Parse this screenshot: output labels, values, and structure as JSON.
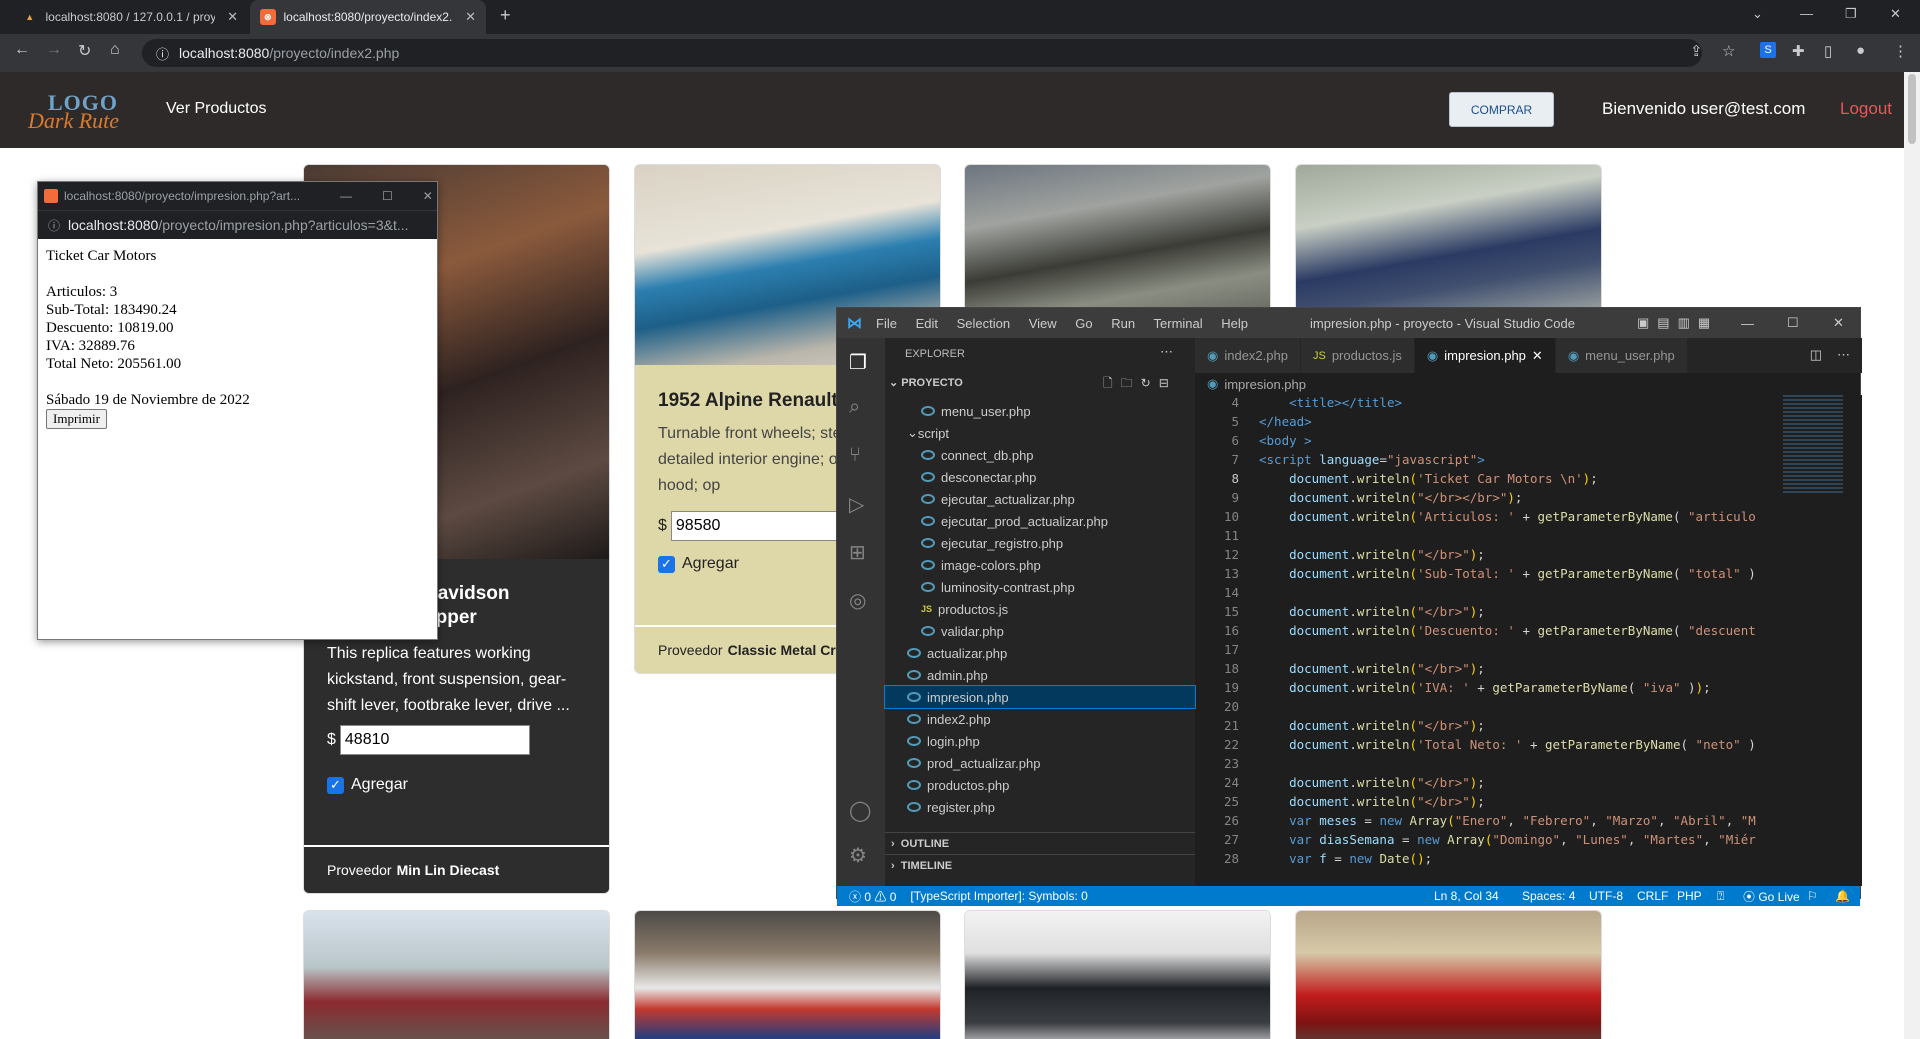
{
  "browser": {
    "tabs": [
      {
        "label": "localhost:8080 / 127.0.0.1 / proye"
      },
      {
        "label": "localhost:8080/proyecto/index2.p"
      }
    ],
    "url_host": "localhost:8080",
    "url_path": "/proyecto/index2.php"
  },
  "site": {
    "logo_top": "LOGO",
    "logo_bottom": "Dark Rute",
    "nav_link": "Ver Productos",
    "buy_button": "COMPRAR",
    "welcome": "Bienvenido user@test.com",
    "logout": "Logout"
  },
  "products": [
    {
      "title_line1": "Davidson",
      "title_line2": "opper",
      "description": "This replica features working kickstand, front suspension, gear-shift lever, footbrake lever, drive ...",
      "price": "48810",
      "checkbox_label": "Agregar",
      "provider_prefix": "Proveedor",
      "provider": "Min Lin Diecast"
    },
    {
      "title": "1952 Alpine Renault",
      "description": "Turnable front wheels; ste function; detailed interior engine; opening hood; op",
      "price": "98580",
      "checkbox_label": "Agregar",
      "provider_prefix": "Proveedor",
      "provider": "Classic Metal Cre"
    }
  ],
  "popup": {
    "title": "localhost:8080/proyecto/impresion.php?art...",
    "url_host": "localhost:8080",
    "url_path": "/proyecto/impresion.php?articulos=3&t...",
    "heading": "Ticket Car Motors",
    "lines": [
      "Articulos: 3",
      "Sub-Total: 183490.24",
      "Descuento: 10819.00",
      "IVA: 32889.76",
      "Total Neto: 205561.00"
    ],
    "date": "Sábado 19 de Noviembre de 2022",
    "print_button": "Imprimir"
  },
  "vscode": {
    "menu": [
      "File",
      "Edit",
      "Selection",
      "View",
      "Go",
      "Run",
      "Terminal",
      "Help"
    ],
    "window_title": "impresion.php - proyecto - Visual Studio Code",
    "explorer_title": "EXPLORER",
    "project": "PROYECTO",
    "tree": [
      {
        "name": "menu_user.php",
        "indent": 2,
        "kind": "php"
      },
      {
        "name": "script",
        "indent": 1,
        "kind": "folder"
      },
      {
        "name": "connect_db.php",
        "indent": 2,
        "kind": "php"
      },
      {
        "name": "desconectar.php",
        "indent": 2,
        "kind": "php"
      },
      {
        "name": "ejecutar_actualizar.php",
        "indent": 2,
        "kind": "php"
      },
      {
        "name": "ejecutar_prod_actualizar.php",
        "indent": 2,
        "kind": "php"
      },
      {
        "name": "ejecutar_registro.php",
        "indent": 2,
        "kind": "php"
      },
      {
        "name": "image-colors.php",
        "indent": 2,
        "kind": "php"
      },
      {
        "name": "luminosity-contrast.php",
        "indent": 2,
        "kind": "php"
      },
      {
        "name": "productos.js",
        "indent": 2,
        "kind": "js"
      },
      {
        "name": "validar.php",
        "indent": 2,
        "kind": "php"
      },
      {
        "name": "actualizar.php",
        "indent": 1,
        "kind": "php"
      },
      {
        "name": "admin.php",
        "indent": 1,
        "kind": "php"
      },
      {
        "name": "impresion.php",
        "indent": 1,
        "kind": "php",
        "selected": true
      },
      {
        "name": "index2.php",
        "indent": 1,
        "kind": "php"
      },
      {
        "name": "login.php",
        "indent": 1,
        "kind": "php"
      },
      {
        "name": "prod_actualizar.php",
        "indent": 1,
        "kind": "php"
      },
      {
        "name": "productos.php",
        "indent": 1,
        "kind": "php"
      },
      {
        "name": "register.php",
        "indent": 1,
        "kind": "php"
      }
    ],
    "outline": "OUTLINE",
    "timeline": "TIMELINE",
    "tabs": [
      "index2.php",
      "productos.js",
      "impresion.php",
      "menu_user.php"
    ],
    "breadcrumb": "impresion.php",
    "status": {
      "errors": "0",
      "warnings": "0",
      "importer": "[TypeScript Importer]: Symbols: 0",
      "position": "Ln 8, Col 34",
      "spaces": "Spaces: 4",
      "encoding": "UTF-8",
      "eol": "CRLF",
      "language": "PHP",
      "golive": "Go Live"
    }
  }
}
